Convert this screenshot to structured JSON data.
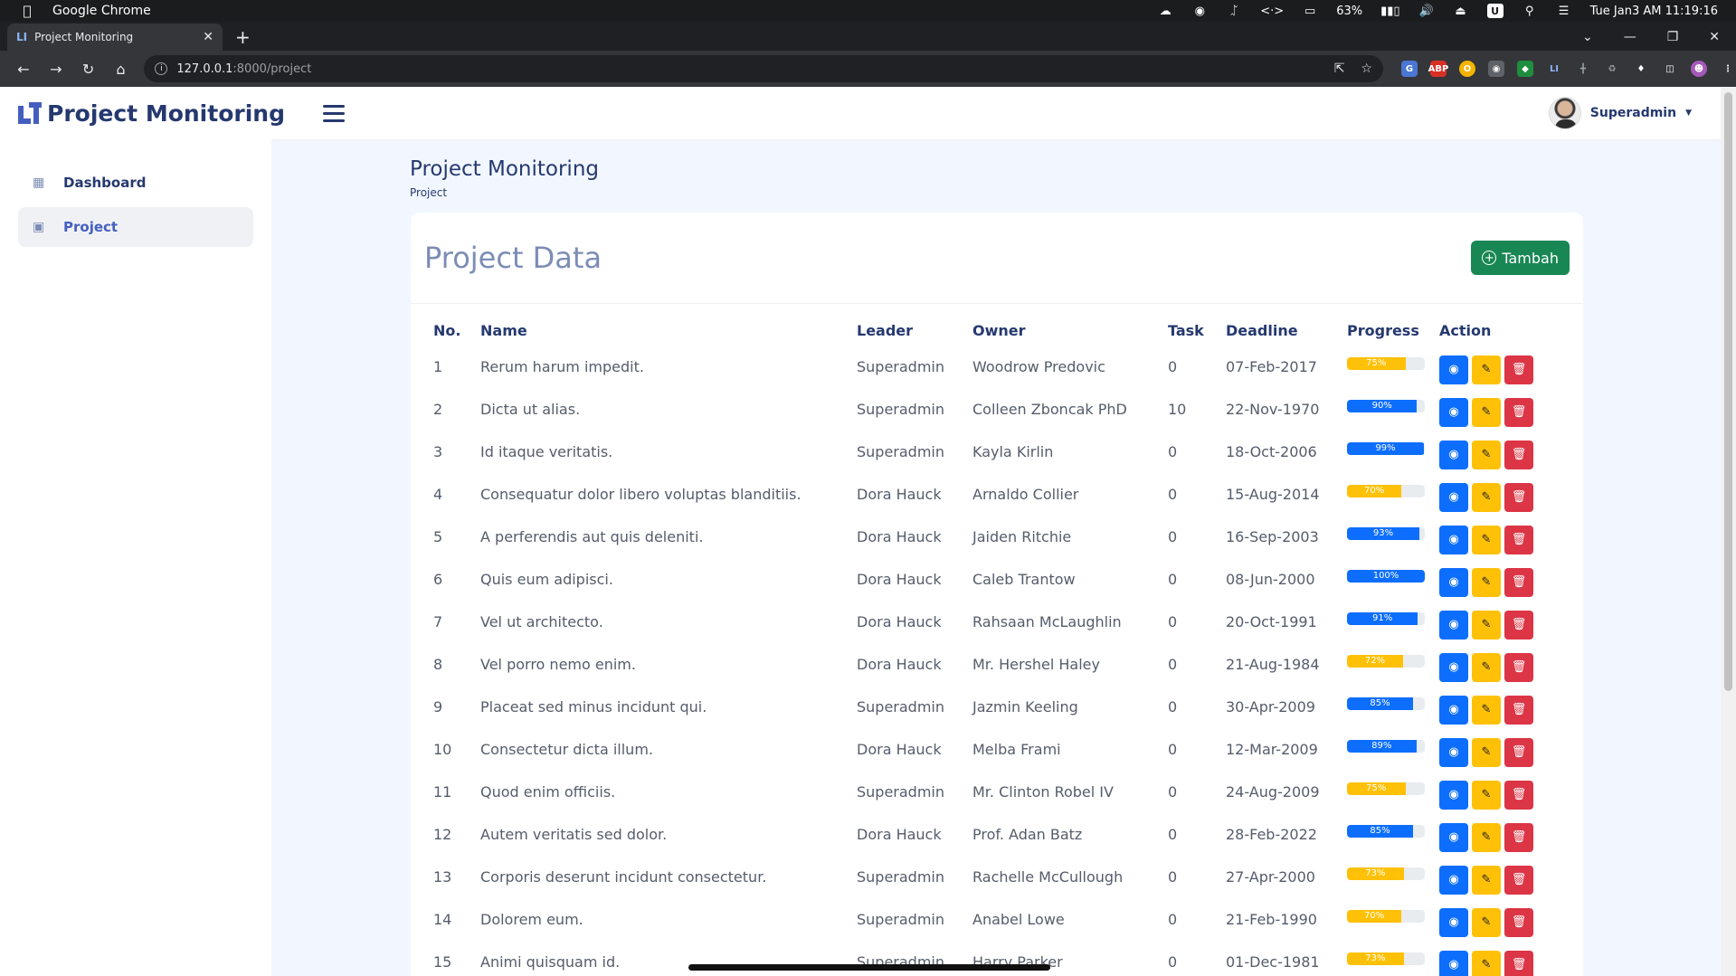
{
  "menubar": {
    "app_name": "Google Chrome",
    "battery": "63%",
    "clock": "Tue Jan3 AM 11:19:16"
  },
  "browser": {
    "tab_title": "Project Monitoring",
    "url_host": "127.0.0.1",
    "url_path": ":8000/project"
  },
  "header": {
    "app_title": "Project Monitoring",
    "user_name": "Superadmin"
  },
  "sidebar": {
    "items": [
      {
        "label": "Dashboard",
        "icon": "grid-icon"
      },
      {
        "label": "Project",
        "icon": "project-icon"
      }
    ]
  },
  "page": {
    "title": "Project Monitoring",
    "breadcrumb": "Project"
  },
  "card": {
    "title": "Project Data",
    "add_label": "Tambah"
  },
  "table": {
    "columns": [
      "No.",
      "Name",
      "Leader",
      "Owner",
      "Task",
      "Deadline",
      "Progress",
      "Action"
    ],
    "rows": [
      {
        "no": "1",
        "name": "Rerum harum impedit.",
        "leader": "Superadmin",
        "owner": "Woodrow Predovic",
        "task": "0",
        "deadline": "07-Feb-2017",
        "progress": 75,
        "progress_label": "75%",
        "color": "yellow"
      },
      {
        "no": "2",
        "name": "Dicta ut alias.",
        "leader": "Superadmin",
        "owner": "Colleen Zboncak PhD",
        "task": "10",
        "deadline": "22-Nov-1970",
        "progress": 90,
        "progress_label": "90%",
        "color": "blue"
      },
      {
        "no": "3",
        "name": "Id itaque veritatis.",
        "leader": "Superadmin",
        "owner": "Kayla Kirlin",
        "task": "0",
        "deadline": "18-Oct-2006",
        "progress": 99,
        "progress_label": "99%",
        "color": "blue"
      },
      {
        "no": "4",
        "name": "Consequatur dolor libero voluptas blanditiis.",
        "leader": "Dora Hauck",
        "owner": "Arnaldo Collier",
        "task": "0",
        "deadline": "15-Aug-2014",
        "progress": 70,
        "progress_label": "70%",
        "color": "yellow"
      },
      {
        "no": "5",
        "name": "A perferendis aut quis deleniti.",
        "leader": "Dora Hauck",
        "owner": "Jaiden Ritchie",
        "task": "0",
        "deadline": "16-Sep-2003",
        "progress": 93,
        "progress_label": "93%",
        "color": "blue"
      },
      {
        "no": "6",
        "name": "Quis eum adipisci.",
        "leader": "Dora Hauck",
        "owner": "Caleb Trantow",
        "task": "0",
        "deadline": "08-Jun-2000",
        "progress": 100,
        "progress_label": "100%",
        "color": "blue"
      },
      {
        "no": "7",
        "name": "Vel ut architecto.",
        "leader": "Dora Hauck",
        "owner": "Rahsaan McLaughlin",
        "task": "0",
        "deadline": "20-Oct-1991",
        "progress": 91,
        "progress_label": "91%",
        "color": "blue"
      },
      {
        "no": "8",
        "name": "Vel porro nemo enim.",
        "leader": "Dora Hauck",
        "owner": "Mr. Hershel Haley",
        "task": "0",
        "deadline": "21-Aug-1984",
        "progress": 72,
        "progress_label": "72%",
        "color": "yellow"
      },
      {
        "no": "9",
        "name": "Placeat sed minus incidunt qui.",
        "leader": "Superadmin",
        "owner": "Jazmin Keeling",
        "task": "0",
        "deadline": "30-Apr-2009",
        "progress": 85,
        "progress_label": "85%",
        "color": "blue"
      },
      {
        "no": "10",
        "name": "Consectetur dicta illum.",
        "leader": "Dora Hauck",
        "owner": "Melba Frami",
        "task": "0",
        "deadline": "12-Mar-2009",
        "progress": 89,
        "progress_label": "89%",
        "color": "blue"
      },
      {
        "no": "11",
        "name": "Quod enim officiis.",
        "leader": "Superadmin",
        "owner": "Mr. Clinton Robel IV",
        "task": "0",
        "deadline": "24-Aug-2009",
        "progress": 75,
        "progress_label": "75%",
        "color": "yellow"
      },
      {
        "no": "12",
        "name": "Autem veritatis sed dolor.",
        "leader": "Dora Hauck",
        "owner": "Prof. Adan Batz",
        "task": "0",
        "deadline": "28-Feb-2022",
        "progress": 85,
        "progress_label": "85%",
        "color": "blue"
      },
      {
        "no": "13",
        "name": "Corporis deserunt incidunt consectetur.",
        "leader": "Superadmin",
        "owner": "Rachelle McCullough",
        "task": "0",
        "deadline": "27-Apr-2000",
        "progress": 73,
        "progress_label": "73%",
        "color": "yellow"
      },
      {
        "no": "14",
        "name": "Dolorem eum.",
        "leader": "Superadmin",
        "owner": "Anabel Lowe",
        "task": "0",
        "deadline": "21-Feb-1990",
        "progress": 70,
        "progress_label": "70%",
        "color": "yellow"
      },
      {
        "no": "15",
        "name": "Animi quisquam id.",
        "leader": "Superadmin",
        "owner": "Harry Parker",
        "task": "0",
        "deadline": "01-Dec-1981",
        "progress": 73,
        "progress_label": "73%",
        "color": "yellow"
      }
    ]
  },
  "colors": {
    "primary": "#435ebe",
    "success": "#198754",
    "progress_blue": "#0d6efd",
    "progress_yellow": "#ffc107",
    "danger": "#dc3545"
  }
}
